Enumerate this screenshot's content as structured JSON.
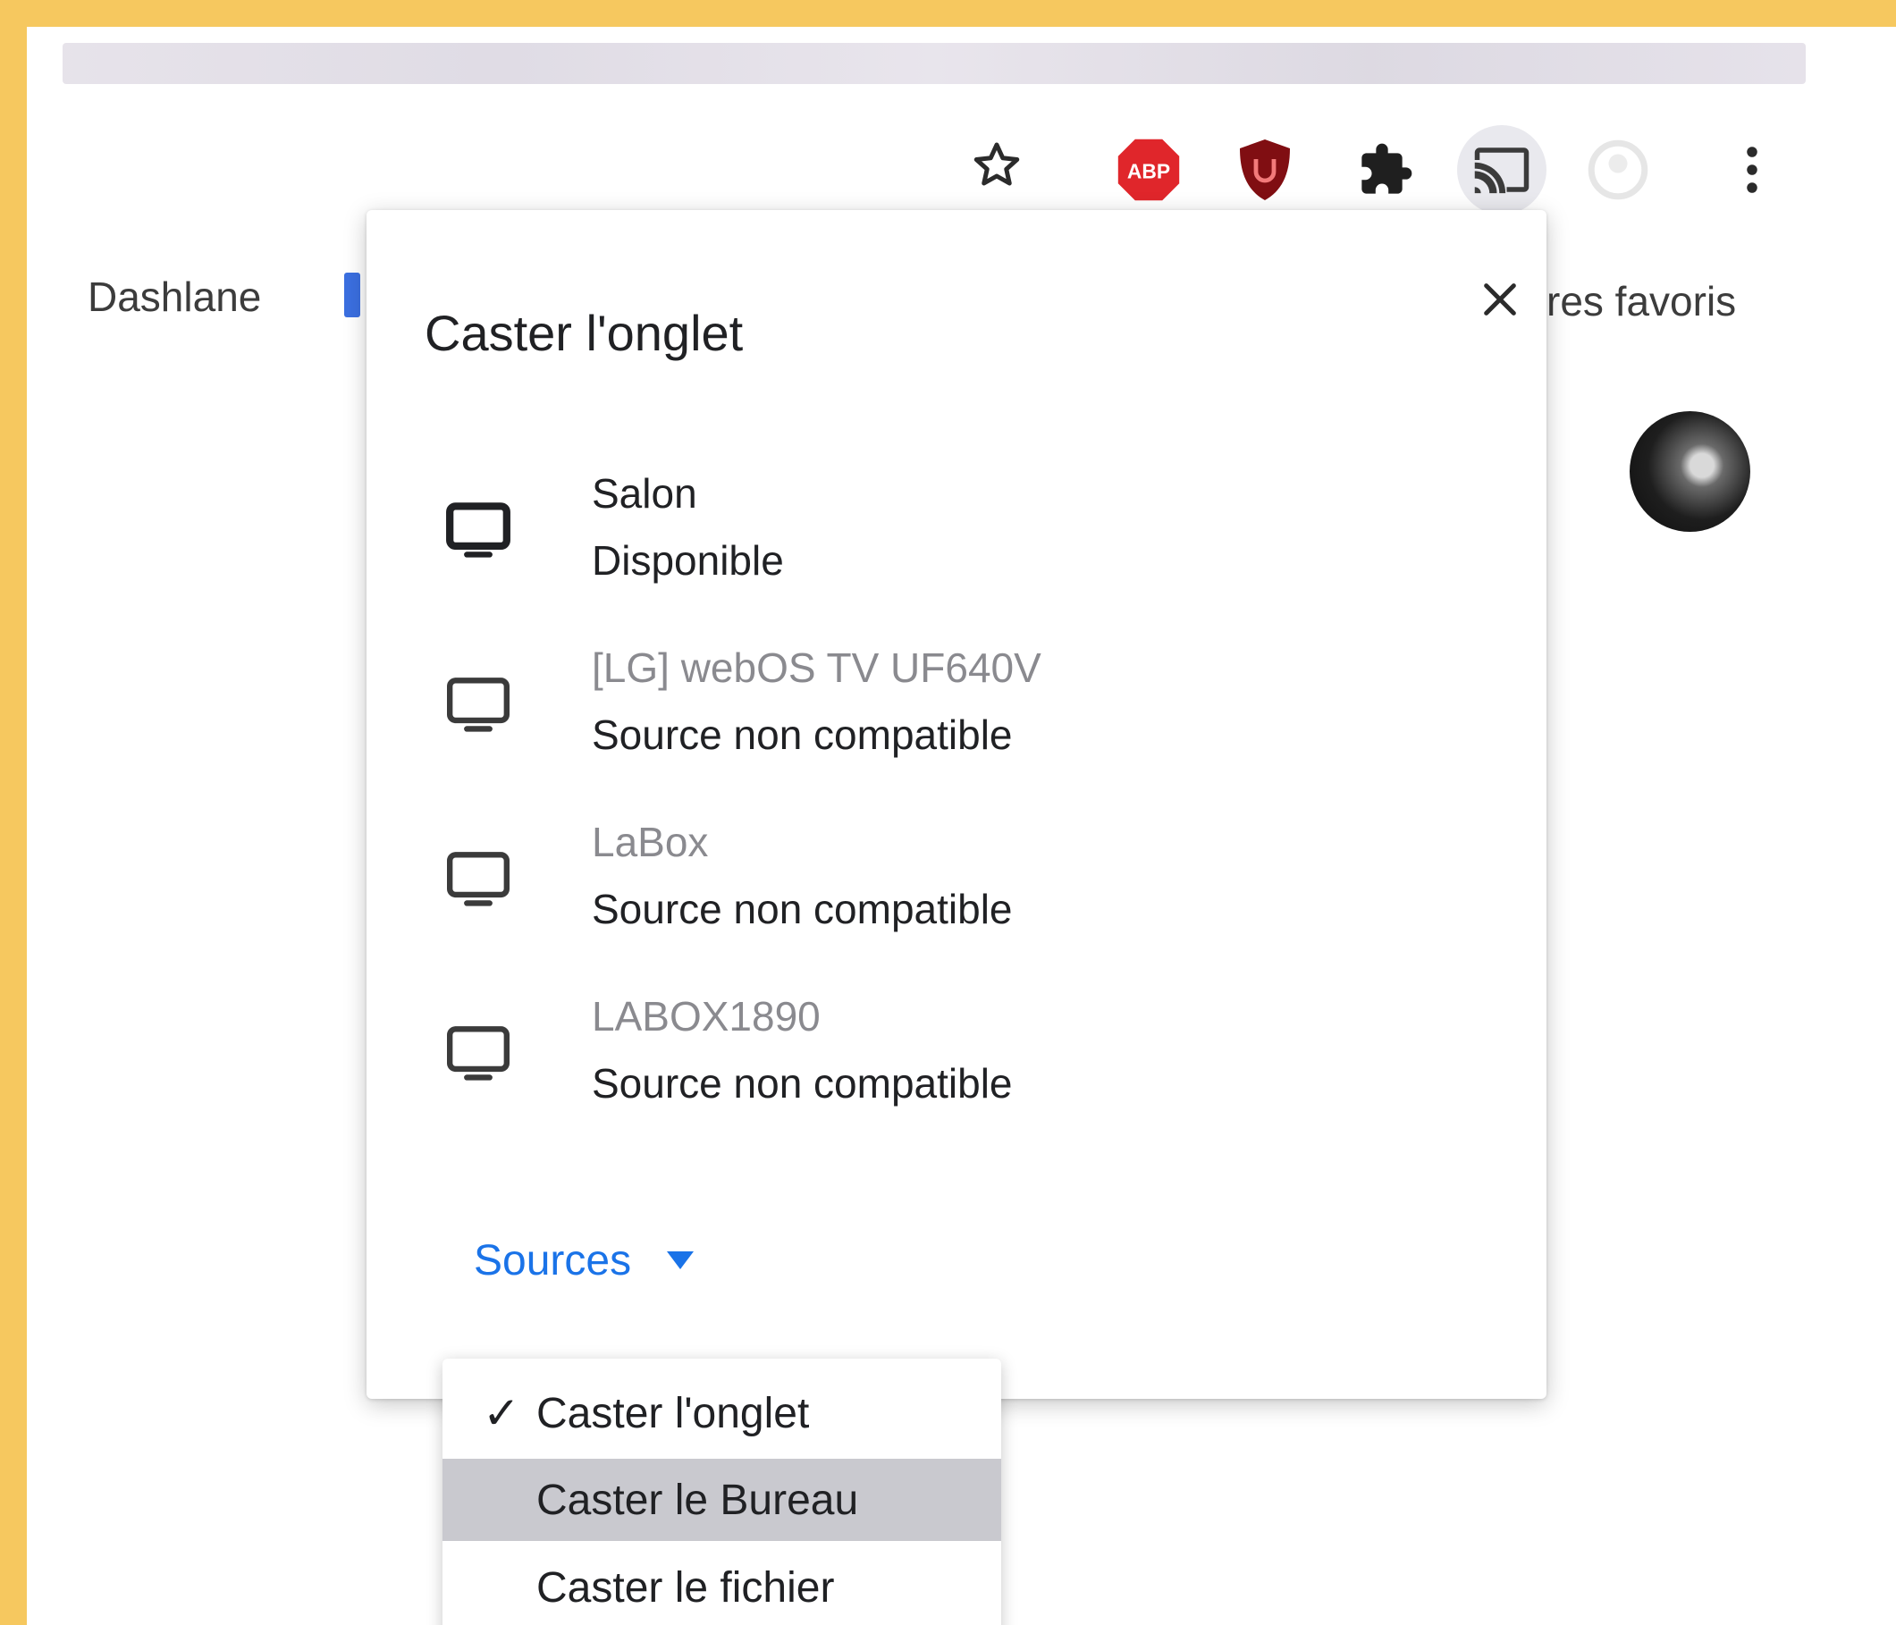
{
  "toolbar": {
    "icons": [
      "star-icon",
      "adblock-plus-icon",
      "ublock-origin-icon",
      "extensions-puzzle-icon",
      "cast-icon",
      "profile-icon",
      "menu-kebab-icon"
    ],
    "adblock_label": "ABP"
  },
  "bookmarks": {
    "dashlane": "Dashlane",
    "others_partial": "res favoris"
  },
  "dialog": {
    "title": "Caster l'onglet",
    "devices": [
      {
        "name": "Salon",
        "status": "Disponible",
        "available": true
      },
      {
        "name": "[LG] webOS TV UF640V",
        "status": "Source non compatible",
        "available": false
      },
      {
        "name": "LaBox",
        "status": "Source non compatible",
        "available": false
      },
      {
        "name": "LABOX1890",
        "status": "Source non compatible",
        "available": false
      }
    ],
    "sources_label": "Sources"
  },
  "sources_menu": {
    "items": [
      {
        "label": "Caster l'onglet",
        "checked": true,
        "check_mark": "✓"
      },
      {
        "label": "Caster le Bureau",
        "checked": false,
        "highlighted": true
      },
      {
        "label": "Caster le fichier",
        "checked": false
      }
    ]
  },
  "colors": {
    "frame": "#f6c85f",
    "accent": "#1a73e8",
    "highlight": "#c9c9cf"
  }
}
